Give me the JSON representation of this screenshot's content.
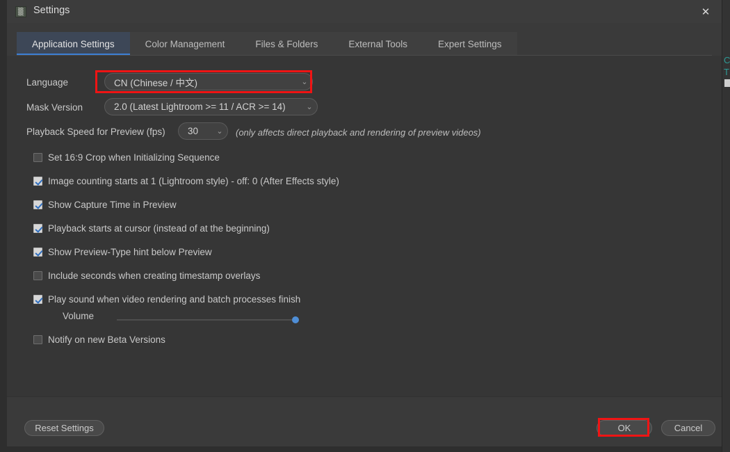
{
  "window": {
    "title": "Settings",
    "app_icon": "app-icon",
    "close_icon": "close-icon",
    "close_glyph": "✕",
    "icon_glyph": "▒"
  },
  "tabs": [
    {
      "label": "Application Settings",
      "active": true
    },
    {
      "label": "Color Management",
      "active": false
    },
    {
      "label": "Files & Folders",
      "active": false
    },
    {
      "label": "External Tools",
      "active": false
    },
    {
      "label": "Expert Settings",
      "active": false
    }
  ],
  "fields": {
    "language": {
      "label": "Language",
      "value": "CN (Chinese / 中文)",
      "chevron": "⌄"
    },
    "mask_version": {
      "label": "Mask Version",
      "value": "2.0 (Latest Lightroom >= 11 / ACR >= 14)",
      "chevron": "⌄"
    },
    "playback_speed": {
      "label": "Playback Speed for Preview (fps)",
      "value": "30",
      "chevron": "⌄",
      "hint": "(only affects direct playback and rendering of preview videos)"
    }
  },
  "checkboxes": [
    {
      "label": "Set 16:9 Crop when Initializing Sequence",
      "checked": false
    },
    {
      "label": "Image counting starts at 1 (Lightroom style) - off: 0 (After Effects style)",
      "checked": true
    },
    {
      "label": "Show Capture Time in Preview",
      "checked": true
    },
    {
      "label": "Playback starts at cursor (instead of at the beginning)",
      "checked": true
    },
    {
      "label": "Show Preview-Type hint below Preview",
      "checked": true
    },
    {
      "label": "Include seconds when creating timestamp overlays",
      "checked": false
    },
    {
      "label": "Play sound when video rendering and batch processes finish",
      "checked": true
    }
  ],
  "volume": {
    "label": "Volume",
    "value": 100
  },
  "notify_beta": {
    "label": "Notify on new Beta Versions",
    "checked": false
  },
  "footer": {
    "reset_label": "Reset Settings",
    "ok_label": "OK",
    "cancel_label": "Cancel"
  },
  "background_window": {
    "text": "C\nT"
  },
  "colors": {
    "accent_blue": "#3c7fd4",
    "annotation_red": "#ef1414",
    "slider_handle": "#4f8ed6",
    "dialog_bg": "#363636",
    "titlebar_bg": "#3c3c3c",
    "active_tab_bg": "#3d4757"
  }
}
